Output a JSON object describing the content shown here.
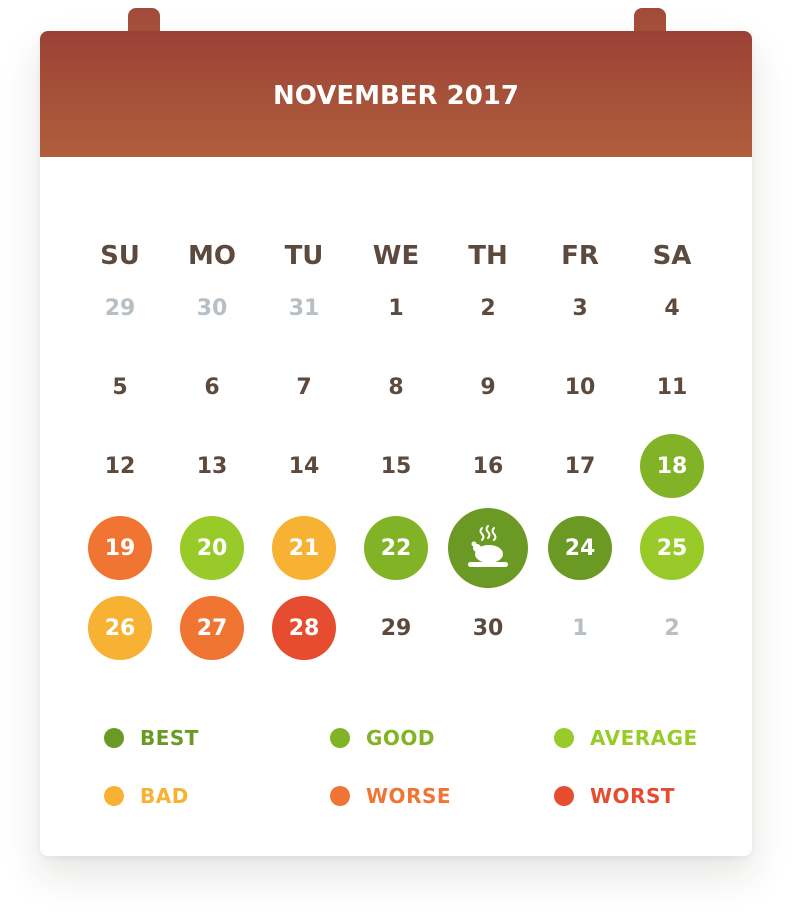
{
  "calendar": {
    "title": "NOVEMBER 2017",
    "weekdays": [
      "SU",
      "MO",
      "TU",
      "WE",
      "TH",
      "FR",
      "SA"
    ]
  },
  "colors": {
    "header": "#a34e3a",
    "text": "#5c4a3e",
    "muted": "#b8bfc4",
    "best": "#6a9a24",
    "good": "#82b326",
    "average": "#98cb2a",
    "bad": "#f7b233",
    "worse": "#f07432",
    "worst": "#e54c30"
  },
  "days": [
    {
      "label": "29",
      "muted": true
    },
    {
      "label": "30",
      "muted": true
    },
    {
      "label": "31",
      "muted": true
    },
    {
      "label": "1"
    },
    {
      "label": "2"
    },
    {
      "label": "3"
    },
    {
      "label": "4"
    },
    {
      "label": "5"
    },
    {
      "label": "6"
    },
    {
      "label": "7"
    },
    {
      "label": "8"
    },
    {
      "label": "9"
    },
    {
      "label": "10"
    },
    {
      "label": "11"
    },
    {
      "label": "12"
    },
    {
      "label": "13"
    },
    {
      "label": "14"
    },
    {
      "label": "15"
    },
    {
      "label": "16"
    },
    {
      "label": "17"
    },
    {
      "label": "18",
      "rating": "good"
    },
    {
      "label": "19",
      "rating": "worse"
    },
    {
      "label": "20",
      "rating": "average"
    },
    {
      "label": "21",
      "rating": "bad"
    },
    {
      "label": "22",
      "rating": "good"
    },
    {
      "label": "",
      "rating": "best",
      "icon": "roast-turkey-icon"
    },
    {
      "label": "24",
      "rating": "best"
    },
    {
      "label": "25",
      "rating": "average"
    },
    {
      "label": "26",
      "rating": "bad"
    },
    {
      "label": "27",
      "rating": "worse"
    },
    {
      "label": "28",
      "rating": "worst"
    },
    {
      "label": "29"
    },
    {
      "label": "30"
    },
    {
      "label": "1",
      "muted": true
    },
    {
      "label": "2",
      "muted": true
    }
  ],
  "legend": [
    {
      "key": "best",
      "label": "BEST"
    },
    {
      "key": "good",
      "label": "GOOD"
    },
    {
      "key": "average",
      "label": "AVERAGE"
    },
    {
      "key": "bad",
      "label": "BAD"
    },
    {
      "key": "worse",
      "label": "WORSE"
    },
    {
      "key": "worst",
      "label": "WORST"
    }
  ]
}
